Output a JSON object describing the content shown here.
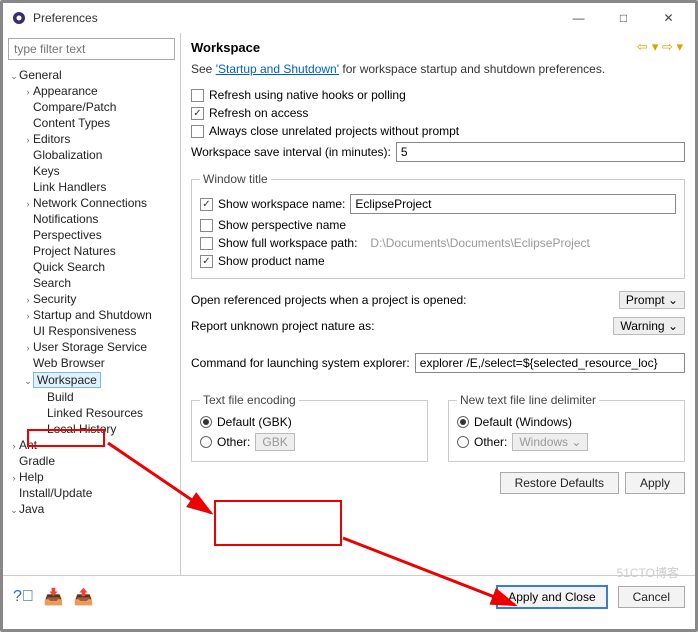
{
  "window": {
    "title": "Preferences",
    "minimize": "—",
    "maximize": "□",
    "close": "✕"
  },
  "sidebar": {
    "filter_placeholder": "type filter text",
    "general": "General",
    "items": [
      "Appearance",
      "Compare/Patch",
      "Content Types",
      "Editors",
      "Globalization",
      "Keys",
      "Link Handlers",
      "Network Connections",
      "Notifications",
      "Perspectives",
      "Project Natures",
      "Quick Search",
      "Search",
      "Security",
      "Startup and Shutdown",
      "UI Responsiveness",
      "User Storage Service",
      "Web Browser"
    ],
    "workspace": "Workspace",
    "ws_children": [
      "Build",
      "Linked Resources",
      "Local History"
    ],
    "others": [
      "Ant",
      "Gradle",
      "Help",
      "Install/Update",
      "Java"
    ]
  },
  "header": {
    "title": "Workspace"
  },
  "see": {
    "pre": "See ",
    "link": "'Startup and Shutdown'",
    "post": " for workspace startup and shutdown preferences."
  },
  "opts": {
    "refresh_hooks": "Refresh using native hooks or polling",
    "refresh_access": "Refresh on access",
    "close_unrelated": "Always close unrelated projects without prompt",
    "save_interval_label": "Workspace save interval (in minutes):",
    "save_interval_value": "5"
  },
  "wtitle": {
    "legend": "Window title",
    "show_ws": "Show workspace name:",
    "ws_value": "EclipseProject",
    "show_persp": "Show perspective name",
    "show_full": "Show full workspace path:",
    "full_value": "D:\\Documents\\Documents\\EclipseProject",
    "show_prod": "Show product name"
  },
  "ref": {
    "open_ref": "Open referenced projects when a project is opened:",
    "open_ref_val": "Prompt",
    "report": "Report unknown project nature as:",
    "report_val": "Warning"
  },
  "cmd": {
    "label": "Command for launching system explorer:",
    "value": "explorer /E,/select=${selected_resource_loc}"
  },
  "enc": {
    "legend": "Text file encoding",
    "default": "Default (GBK)",
    "other": "Other:",
    "other_val": "GBK"
  },
  "delim": {
    "legend": "New text file line delimiter",
    "default": "Default (Windows)",
    "other": "Other:",
    "other_val": "Windows"
  },
  "btns": {
    "restore": "Restore Defaults",
    "apply": "Apply",
    "apply_close": "Apply and Close",
    "cancel": "Cancel"
  },
  "watermark": "51CTO博客"
}
